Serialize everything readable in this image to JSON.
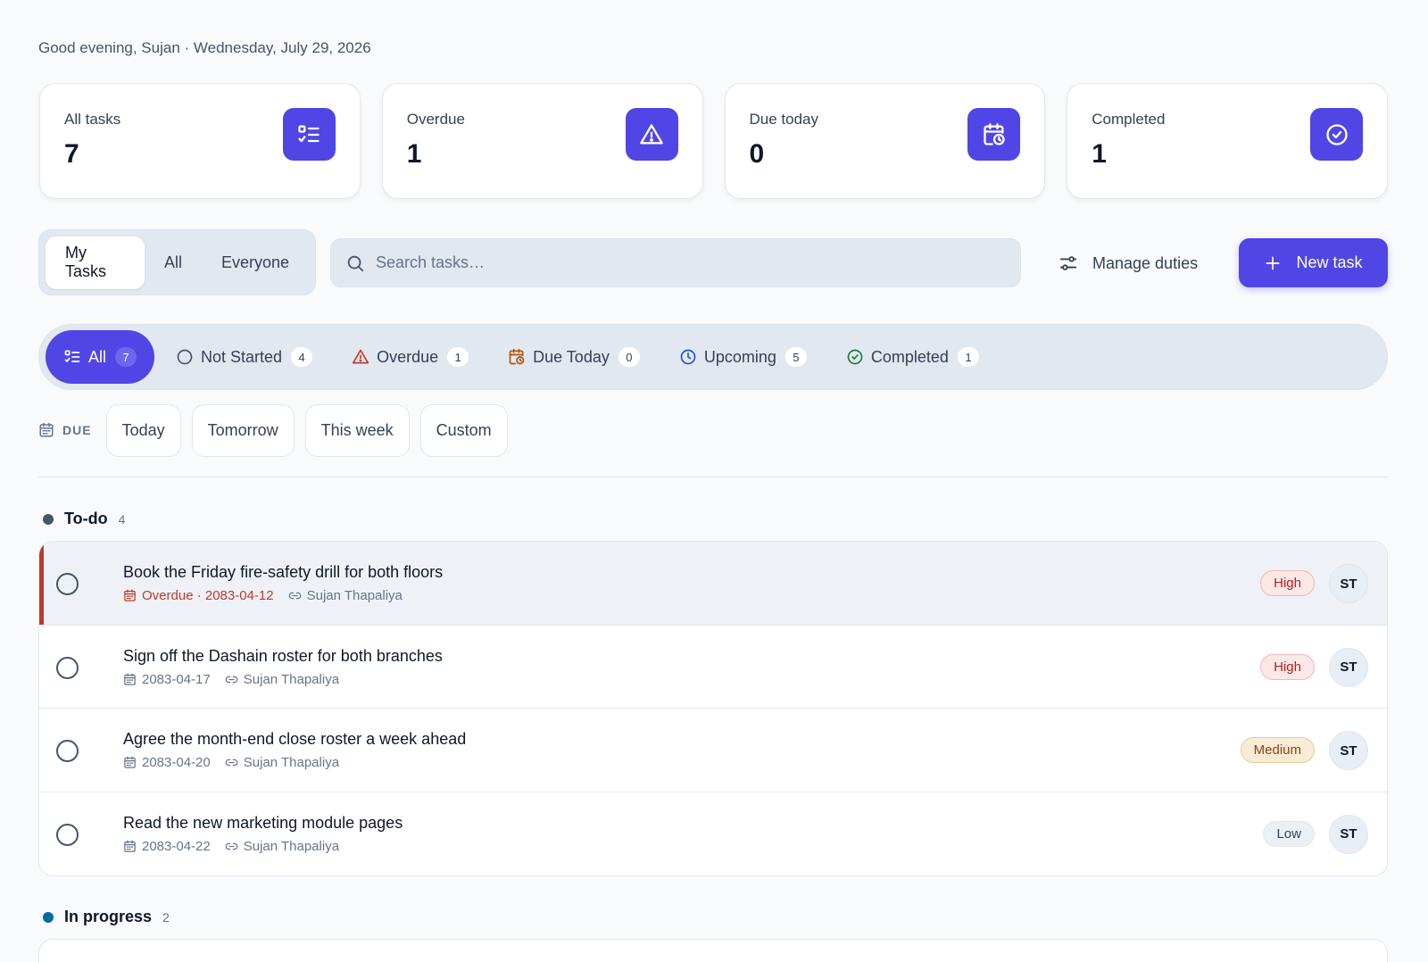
{
  "greeting": "Good evening, Sujan · Wednesday, July 29, 2026",
  "stats": [
    {
      "label": "All tasks",
      "value": "7",
      "icon": "list-check-icon"
    },
    {
      "label": "Overdue",
      "value": "1",
      "icon": "warning-icon"
    },
    {
      "label": "Due today",
      "value": "0",
      "icon": "calendar-clock-icon"
    },
    {
      "label": "Completed",
      "value": "1",
      "icon": "check-circle-icon"
    }
  ],
  "scope_tabs": [
    "My Tasks",
    "All",
    "Everyone"
  ],
  "search": {
    "placeholder": "Search tasks…"
  },
  "manage_duties": "Manage duties",
  "new_task": "New task",
  "status_filters": [
    {
      "label": "All",
      "count": "7"
    },
    {
      "label": "Not Started",
      "count": "4"
    },
    {
      "label": "Overdue",
      "count": "1"
    },
    {
      "label": "Due Today",
      "count": "0"
    },
    {
      "label": "Upcoming",
      "count": "5"
    },
    {
      "label": "Completed",
      "count": "1"
    }
  ],
  "due": {
    "label": "DUE",
    "options": [
      "Today",
      "Tomorrow",
      "This week",
      "Custom"
    ]
  },
  "groups": [
    {
      "name": "To-do",
      "count": "4",
      "color": "#475569",
      "tasks": [
        {
          "title": "Book the Friday fire-safety drill for both floors",
          "date": "Overdue · 2083-04-12",
          "assignee": "Sujan Thapaliya",
          "priority": "High",
          "avatar": "ST"
        },
        {
          "title": "Sign off the Dashain roster for both branches",
          "date": "2083-04-17",
          "assignee": "Sujan Thapaliya",
          "priority": "High",
          "avatar": "ST"
        },
        {
          "title": "Agree the month-end close roster a week ahead",
          "date": "2083-04-20",
          "assignee": "Sujan Thapaliya",
          "priority": "Medium",
          "avatar": "ST"
        },
        {
          "title": "Read the new marketing module pages",
          "date": "2083-04-22",
          "assignee": "Sujan Thapaliya",
          "priority": "Low",
          "avatar": "ST"
        }
      ]
    },
    {
      "name": "In progress",
      "count": "2",
      "color": "#0369a1"
    }
  ],
  "colors": {
    "accent": "#4f46e5",
    "overdue": "#c0392b",
    "background": "#f8fafc"
  }
}
